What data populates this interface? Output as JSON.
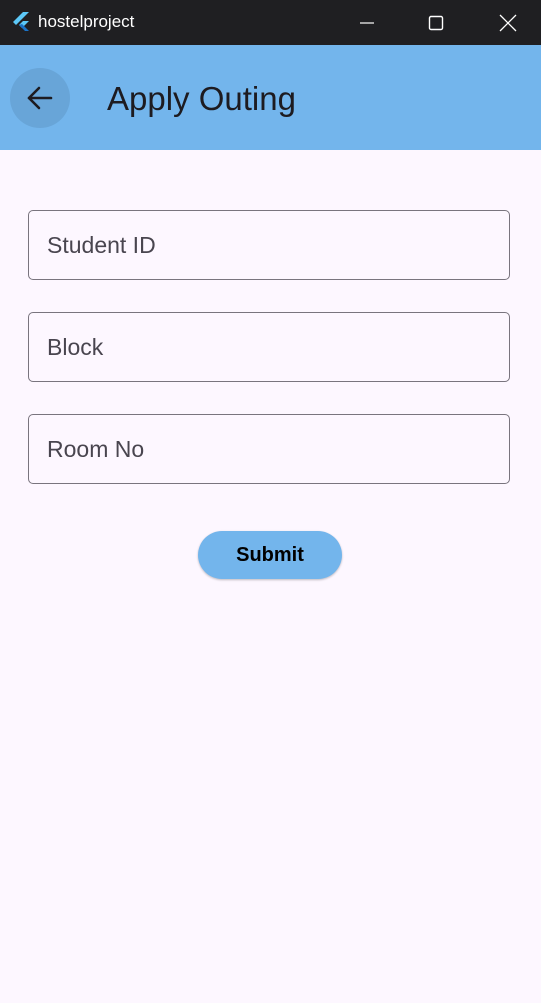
{
  "window": {
    "title": "hostelproject",
    "controls": [
      "minimize-icon",
      "maximize-icon",
      "close-icon"
    ]
  },
  "appbar": {
    "title": "Apply Outing",
    "back_icon": "arrow-back-icon",
    "color": "#73b5ec"
  },
  "form": {
    "student_id": {
      "placeholder": "Student ID",
      "value": ""
    },
    "block": {
      "placeholder": "Block",
      "value": ""
    },
    "room_no": {
      "placeholder": "Room No",
      "value": ""
    },
    "submit_label": "Submit"
  },
  "colors": {
    "background": "#fdf7ff",
    "titlebar": "#1f1f22",
    "accent": "#73b5ec",
    "field_border": "#79747e"
  }
}
